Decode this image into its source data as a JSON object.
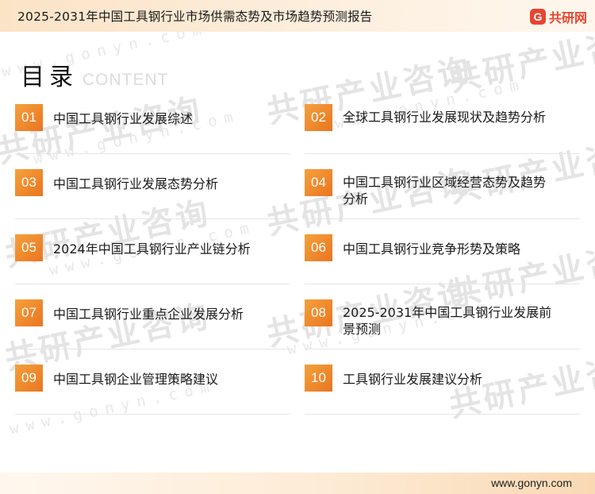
{
  "header": {
    "title": "2025-2031年中国工具钢行业市场供需态势及市场趋势预测报告",
    "logo_mark": "G",
    "logo_text": "共研网"
  },
  "watermark": {
    "text": "共研产业咨询",
    "url_text": "www.gonyn.com"
  },
  "heading": {
    "title": "目录",
    "subtitle": "CONTENT"
  },
  "toc": [
    {
      "num": "01",
      "label": "中国工具钢行业发展综述"
    },
    {
      "num": "02",
      "label": "全球工具钢行业发展现状及趋势分析"
    },
    {
      "num": "03",
      "label": "中国工具钢行业发展态势分析"
    },
    {
      "num": "04",
      "label": "中国工具钢行业区域经营态势及趋势分析"
    },
    {
      "num": "05",
      "label": "2024年中国工具钢行业产业链分析"
    },
    {
      "num": "06",
      "label": "中国工具钢行业竞争形势及策略"
    },
    {
      "num": "07",
      "label": "中国工具钢行业重点企业发展分析"
    },
    {
      "num": "08",
      "label": "2025-2031年中国工具钢行业发展前景预测"
    },
    {
      "num": "09",
      "label": "中国工具钢企业管理策略建议"
    },
    {
      "num": "10",
      "label": "工具钢行业发展建议分析"
    }
  ],
  "footer": {
    "url": "www.gonyn.com"
  },
  "colors": {
    "accent": "#ea7520",
    "brand": "#e8452f"
  }
}
